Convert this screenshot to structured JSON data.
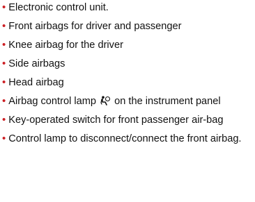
{
  "list": {
    "bullet_char": "•",
    "bullet_color": "#cc1f24",
    "items": [
      {
        "text": "Electronic control unit."
      },
      {
        "text": "Front airbags for driver and passenger"
      },
      {
        "text": "Knee airbag for the driver"
      },
      {
        "text": "Side airbags"
      },
      {
        "text": "Head airbag"
      },
      {
        "text_before": "Airbag control lamp",
        "icon": "airbag-seated-person-icon",
        "text_after": "on the instrument panel"
      },
      {
        "text": "Key-operated switch for front passenger air-bag"
      },
      {
        "text": "Control lamp to disconnect/connect the front airbag."
      }
    ]
  }
}
